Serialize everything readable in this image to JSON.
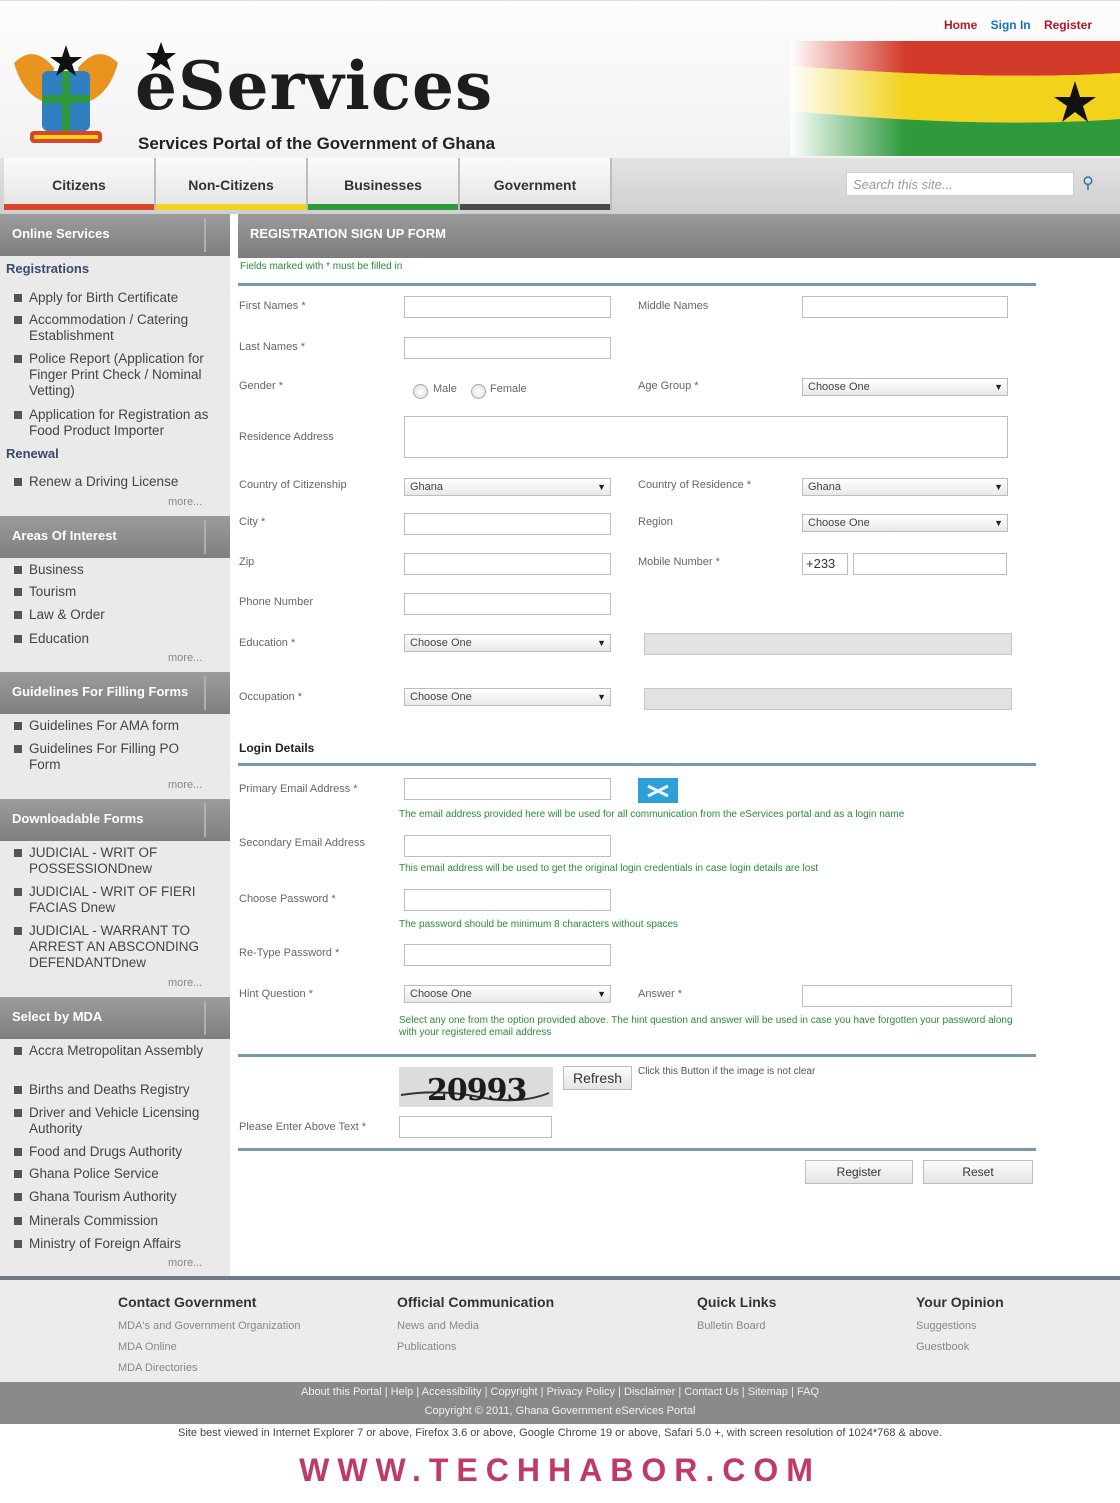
{
  "top_links": {
    "home": "Home",
    "signin": "Sign In",
    "register": "Register"
  },
  "header": {
    "title": "eServices",
    "subtitle": "Services Portal of the Government of Ghana"
  },
  "nav": {
    "tabs": [
      "Citizens",
      "Non-Citizens",
      "Businesses",
      "Government"
    ],
    "search_placeholder": "Search this site..."
  },
  "sidebar": {
    "online_services": "Online Services",
    "registrations": "Registrations",
    "reg_items": [
      "Apply for Birth Certificate",
      "Accommodation / Catering Establishment",
      "Police Report (Application for Finger Print Check / Nominal Vetting)",
      "Application for Registration as Food Product Importer"
    ],
    "renewal": "Renewal",
    "renewal_items": [
      "Renew a Driving License"
    ],
    "areas": "Areas Of Interest",
    "area_items": [
      "Business",
      "Tourism",
      "Law & Order",
      "Education"
    ],
    "guidelines": "Guidelines For Filling Forms",
    "guide_items": [
      "Guidelines For AMA form",
      "Guidelines For Filling PO Form"
    ],
    "downloadable": "Downloadable Forms",
    "download_items": [
      "JUDICIAL - WRIT OF POSSESSIONDnew",
      "JUDICIAL - WRIT OF FIERI FACIAS Dnew",
      "JUDICIAL - WARRANT TO ARREST AN ABSCONDING DEFENDANTDnew"
    ],
    "mda": "Select by MDA",
    "mda_items": [
      "Accra Metropolitan Assembly",
      "Births and Deaths Registry",
      "Driver and Vehicle Licensing Authority",
      "Food and Drugs Authority",
      "Ghana Police Service",
      "Ghana Tourism Authority",
      "Minerals Commission",
      "Ministry of Foreign Affairs"
    ],
    "more": "more..."
  },
  "form": {
    "title": "REGISTRATION SIGN UP FORM",
    "required_note": "Fields marked with * must be filled in",
    "first_names": "First Names *",
    "middle_names": "Middle Names",
    "last_names": "Last Names *",
    "gender": "Gender *",
    "male": "Male",
    "female": "Female",
    "age_group": "Age Group *",
    "choose_one": "Choose One",
    "residence_address": "Residence Address",
    "country_citizenship": "Country of Citizenship",
    "country_residence": "Country of Residence *",
    "ghana": "Ghana",
    "city": "City *",
    "region": "Region",
    "zip": "Zip",
    "mobile_number": "Mobile Number *",
    "mobile_prefix": "+233",
    "phone_number": "Phone Number",
    "education": "Education *",
    "occupation": "Occupation *",
    "login_details": "Login Details",
    "primary_email": "Primary Email Address *",
    "primary_email_note": "The email address provided here will be used for all communication from the eServices portal and as a login name",
    "secondary_email": "Secondary Email Address",
    "secondary_email_note": "This email address will be used to get the original login credentials in case login details are lost",
    "choose_password": "Choose Password *",
    "password_note": "The password should be minimum 8 characters without spaces",
    "retype_password": "Re-Type Password *",
    "hint_question": "Hint Question *",
    "answer": "Answer *",
    "hint_note": "Select any one from the option provided above. The hint question and answer will be used in case you have forgotten your password along with your registered email address",
    "captcha_text": "20993",
    "refresh": "Refresh",
    "refresh_note": "Click this Button if the image is not clear",
    "enter_text": "Please Enter Above Text *",
    "register": "Register",
    "reset": "Reset"
  },
  "footer": {
    "contact": "Contact Government",
    "contact_links": [
      "MDA's and Government Organization",
      "MDA Online",
      "MDA Directories"
    ],
    "official": "Official Communication",
    "official_links": [
      "News and Media",
      "Publications"
    ],
    "quick": "Quick Links",
    "quick_links": [
      "Bulletin Board"
    ],
    "opinion": "Your Opinion",
    "opinion_links": [
      "Suggestions",
      "Guestbook"
    ],
    "bar_links": "About this Portal | Help | Accessibility | Copyright | Privacy Policy | Disclaimer | Contact Us | Sitemap | FAQ",
    "copyright": "Copyright © 2011, Ghana Government eServices Portal",
    "best_viewed": "Site best viewed in Internet Explorer 7 or above, Firefox 3.6 or above, Google Chrome 19 or above, Safari 5.0 +, with screen resolution of 1024*768 & above."
  },
  "watermark": "WWW.TECHHABOR.COM",
  "colors": {
    "red": "#d9452b",
    "yellow": "#f2d21b",
    "green": "#2e9a3c",
    "dark": "#4a4a4a",
    "link_red": "#b5172b",
    "link_blue": "#1c6fb8",
    "note_green": "#2a8a3a"
  }
}
